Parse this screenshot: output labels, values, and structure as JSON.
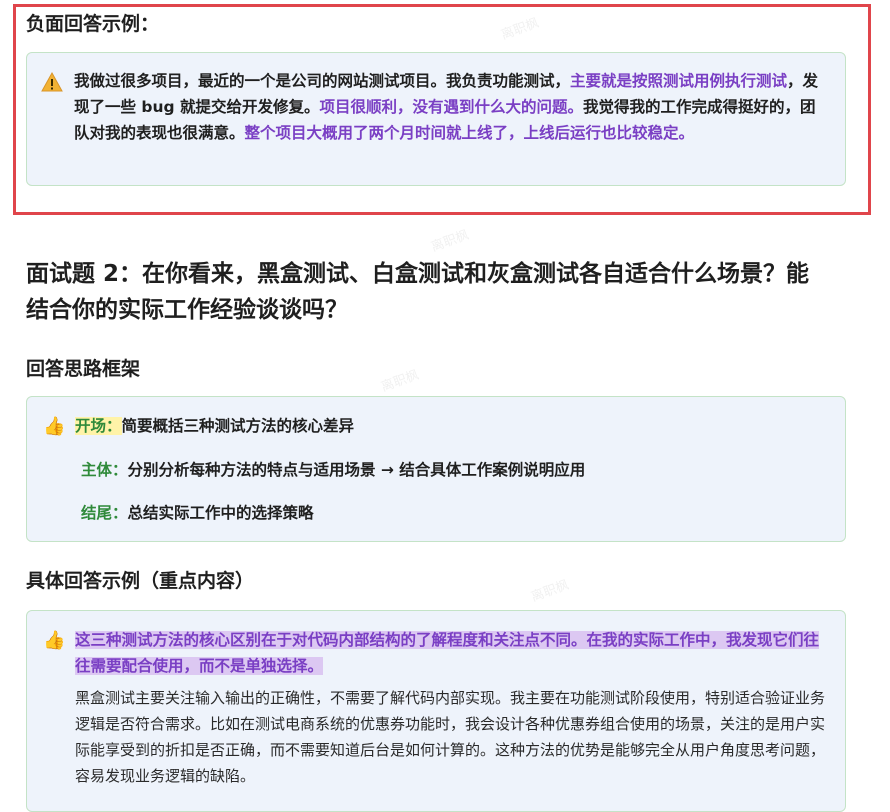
{
  "negative_example": {
    "heading": "负面回答示例：",
    "warning_icon": "warning-icon",
    "seg1": "我做过很多项目，最近的一个是公司的网站测试项目。我负责功能测试，",
    "seg2": "主要就是按照测试用例执行测试",
    "seg3": "，发现了一些 bug 就提交给开发修复。",
    "seg4": "项目很顺利，没有遇到什么大的问题。",
    "seg5": "我觉得我的工作完成得挺好的，团队对我的表现也很满意。",
    "seg6": "整个项目大概用了两个月时间就上线了，上线后运行也比较稳定。"
  },
  "question": {
    "title": "面试题 2：在你看来，黑盒测试、白盒测试和灰盒测试各自适合什么场景？能结合你的实际工作经验谈谈吗？"
  },
  "framework": {
    "heading": "回答思路框架",
    "icon": "thumbs-up-icon",
    "items": [
      {
        "label": "开场：",
        "text": "简要概括三种测试方法的核心差异"
      },
      {
        "label": "主体：",
        "text": "分别分析每种方法的特点与适用场景 → 结合具体工作案例说明应用"
      },
      {
        "label": "结尾：",
        "text": "总结实际工作中的选择策略"
      }
    ]
  },
  "example": {
    "heading": "具体回答示例（重点内容）",
    "icon": "thumbs-up-icon",
    "lead": "这三种测试方法的核心区别在于对代码内部结构的了解程度和关注点不同。在我的实际工作中，我发现它们往往需要配合使用，而不是单独选择。",
    "paragraph": "黑盒测试主要关注输入输出的正确性，不需要了解代码内部实现。我主要在功能测试阶段使用，特别适合验证业务逻辑是否符合需求。比如在测试电商系统的优惠券功能时，我会设计各种优惠券组合使用的场景，关注的是用户实际能享受到的折扣是否正确，而不需要知道后台是如何计算的。这种方法的优势是能够完全从用户角度思考问题，容易发现业务逻辑的缺陷。"
  },
  "watermark": "离职枫",
  "colors": {
    "purple": "#7a3fc4",
    "green": "#2f8a3a",
    "frame": "#e0454b",
    "box_bg": "#eef3fb"
  }
}
